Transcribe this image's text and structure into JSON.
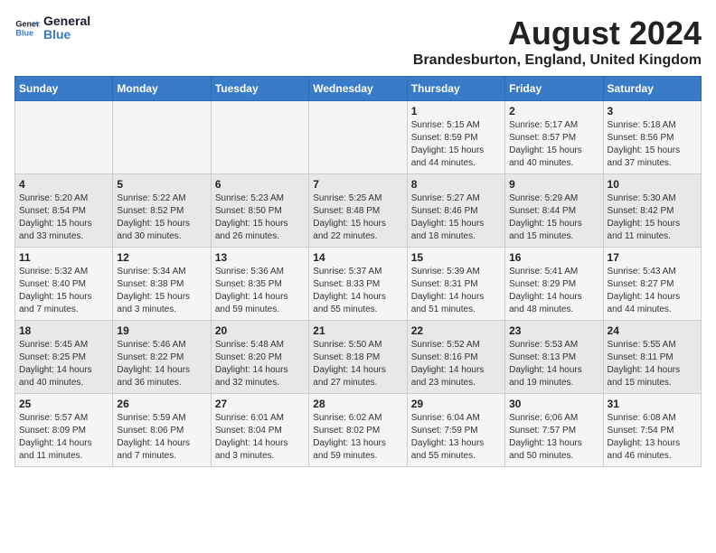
{
  "header": {
    "logo_line1": "General",
    "logo_line2": "Blue",
    "title": "August 2024",
    "subtitle": "Brandesburton, England, United Kingdom"
  },
  "calendar": {
    "days_of_week": [
      "Sunday",
      "Monday",
      "Tuesday",
      "Wednesday",
      "Thursday",
      "Friday",
      "Saturday"
    ],
    "weeks": [
      [
        {
          "day": "",
          "info": ""
        },
        {
          "day": "",
          "info": ""
        },
        {
          "day": "",
          "info": ""
        },
        {
          "day": "",
          "info": ""
        },
        {
          "day": "1",
          "info": "Sunrise: 5:15 AM\nSunset: 8:59 PM\nDaylight: 15 hours\nand 44 minutes."
        },
        {
          "day": "2",
          "info": "Sunrise: 5:17 AM\nSunset: 8:57 PM\nDaylight: 15 hours\nand 40 minutes."
        },
        {
          "day": "3",
          "info": "Sunrise: 5:18 AM\nSunset: 8:56 PM\nDaylight: 15 hours\nand 37 minutes."
        }
      ],
      [
        {
          "day": "4",
          "info": "Sunrise: 5:20 AM\nSunset: 8:54 PM\nDaylight: 15 hours\nand 33 minutes."
        },
        {
          "day": "5",
          "info": "Sunrise: 5:22 AM\nSunset: 8:52 PM\nDaylight: 15 hours\nand 30 minutes."
        },
        {
          "day": "6",
          "info": "Sunrise: 5:23 AM\nSunset: 8:50 PM\nDaylight: 15 hours\nand 26 minutes."
        },
        {
          "day": "7",
          "info": "Sunrise: 5:25 AM\nSunset: 8:48 PM\nDaylight: 15 hours\nand 22 minutes."
        },
        {
          "day": "8",
          "info": "Sunrise: 5:27 AM\nSunset: 8:46 PM\nDaylight: 15 hours\nand 18 minutes."
        },
        {
          "day": "9",
          "info": "Sunrise: 5:29 AM\nSunset: 8:44 PM\nDaylight: 15 hours\nand 15 minutes."
        },
        {
          "day": "10",
          "info": "Sunrise: 5:30 AM\nSunset: 8:42 PM\nDaylight: 15 hours\nand 11 minutes."
        }
      ],
      [
        {
          "day": "11",
          "info": "Sunrise: 5:32 AM\nSunset: 8:40 PM\nDaylight: 15 hours\nand 7 minutes."
        },
        {
          "day": "12",
          "info": "Sunrise: 5:34 AM\nSunset: 8:38 PM\nDaylight: 15 hours\nand 3 minutes."
        },
        {
          "day": "13",
          "info": "Sunrise: 5:36 AM\nSunset: 8:35 PM\nDaylight: 14 hours\nand 59 minutes."
        },
        {
          "day": "14",
          "info": "Sunrise: 5:37 AM\nSunset: 8:33 PM\nDaylight: 14 hours\nand 55 minutes."
        },
        {
          "day": "15",
          "info": "Sunrise: 5:39 AM\nSunset: 8:31 PM\nDaylight: 14 hours\nand 51 minutes."
        },
        {
          "day": "16",
          "info": "Sunrise: 5:41 AM\nSunset: 8:29 PM\nDaylight: 14 hours\nand 48 minutes."
        },
        {
          "day": "17",
          "info": "Sunrise: 5:43 AM\nSunset: 8:27 PM\nDaylight: 14 hours\nand 44 minutes."
        }
      ],
      [
        {
          "day": "18",
          "info": "Sunrise: 5:45 AM\nSunset: 8:25 PM\nDaylight: 14 hours\nand 40 minutes."
        },
        {
          "day": "19",
          "info": "Sunrise: 5:46 AM\nSunset: 8:22 PM\nDaylight: 14 hours\nand 36 minutes."
        },
        {
          "day": "20",
          "info": "Sunrise: 5:48 AM\nSunset: 8:20 PM\nDaylight: 14 hours\nand 32 minutes."
        },
        {
          "day": "21",
          "info": "Sunrise: 5:50 AM\nSunset: 8:18 PM\nDaylight: 14 hours\nand 27 minutes."
        },
        {
          "day": "22",
          "info": "Sunrise: 5:52 AM\nSunset: 8:16 PM\nDaylight: 14 hours\nand 23 minutes."
        },
        {
          "day": "23",
          "info": "Sunrise: 5:53 AM\nSunset: 8:13 PM\nDaylight: 14 hours\nand 19 minutes."
        },
        {
          "day": "24",
          "info": "Sunrise: 5:55 AM\nSunset: 8:11 PM\nDaylight: 14 hours\nand 15 minutes."
        }
      ],
      [
        {
          "day": "25",
          "info": "Sunrise: 5:57 AM\nSunset: 8:09 PM\nDaylight: 14 hours\nand 11 minutes."
        },
        {
          "day": "26",
          "info": "Sunrise: 5:59 AM\nSunset: 8:06 PM\nDaylight: 14 hours\nand 7 minutes."
        },
        {
          "day": "27",
          "info": "Sunrise: 6:01 AM\nSunset: 8:04 PM\nDaylight: 14 hours\nand 3 minutes."
        },
        {
          "day": "28",
          "info": "Sunrise: 6:02 AM\nSunset: 8:02 PM\nDaylight: 13 hours\nand 59 minutes."
        },
        {
          "day": "29",
          "info": "Sunrise: 6:04 AM\nSunset: 7:59 PM\nDaylight: 13 hours\nand 55 minutes."
        },
        {
          "day": "30",
          "info": "Sunrise: 6:06 AM\nSunset: 7:57 PM\nDaylight: 13 hours\nand 50 minutes."
        },
        {
          "day": "31",
          "info": "Sunrise: 6:08 AM\nSunset: 7:54 PM\nDaylight: 13 hours\nand 46 minutes."
        }
      ]
    ]
  }
}
